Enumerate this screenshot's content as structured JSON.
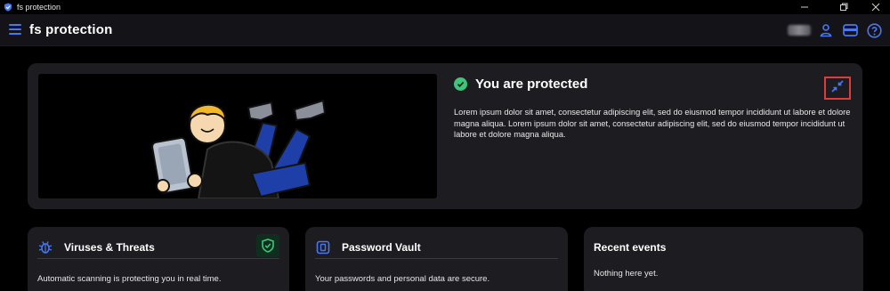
{
  "window": {
    "title": "fs protection",
    "controls": [
      "minimize",
      "restore",
      "close"
    ]
  },
  "header": {
    "title": "fs protection",
    "icons": [
      "menu-icon",
      "user-icon",
      "wallet-icon",
      "help-icon"
    ],
    "accent": "#4a76f0"
  },
  "hero": {
    "status_title": "You are protected",
    "status_color": "#3fc47a",
    "body": "Lorem ipsum dolor sit amet, consectetur adipiscing elit, sed do eiusmod tempor incididunt ut labore et dolore magna aliqua. Lorem ipsum dolor sit amet, consectetur adipiscing elit, sed do eiusmod tempor incididunt ut labore et dolore magna aliqua.",
    "collapse_icon": "collapse-arrows-icon"
  },
  "cards": [
    {
      "title": "Viruses & Threats",
      "icon": "bug-icon",
      "text": "Automatic scanning is protecting you in real time.",
      "badge_icon": "shield-check-icon"
    },
    {
      "title": "Password Vault",
      "icon": "vault-icon",
      "text": "Your passwords and personal data are secure."
    },
    {
      "title": "Recent events",
      "text": "Nothing here yet."
    }
  ]
}
